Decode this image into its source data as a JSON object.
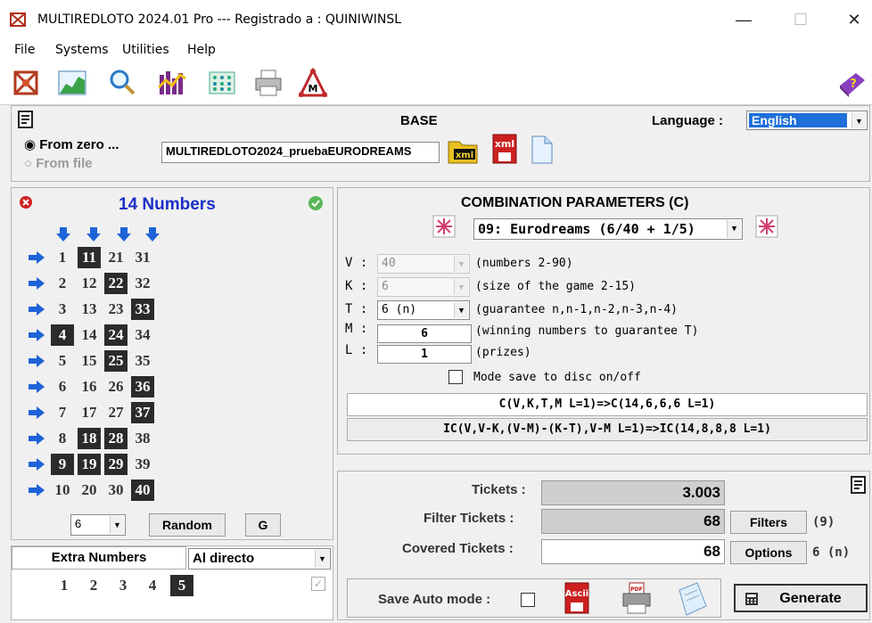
{
  "window": {
    "title": "MULTIREDLOTO 2024.01 Pro --- Registrado a : QUINIWINSL",
    "minimize": "—",
    "maximize": "☐",
    "close": "✕"
  },
  "menu": [
    "File",
    "Systems",
    "Utilities",
    "Help"
  ],
  "base": {
    "title": "BASE",
    "language_label": "Language :",
    "language_value": "English",
    "from_zero": "From zero ...",
    "from_file": "From file",
    "filename": "MULTIREDLOTO2024_pruebaEURODREAMS",
    "xml_label": "xml",
    "xml_label2": "xml"
  },
  "numbers_panel": {
    "title": "14 Numbers",
    "rows": [
      [
        {
          "n": "1",
          "s": false
        },
        {
          "n": "11",
          "s": true
        },
        {
          "n": "21",
          "s": false
        },
        {
          "n": "31",
          "s": false
        }
      ],
      [
        {
          "n": "2",
          "s": false
        },
        {
          "n": "12",
          "s": false
        },
        {
          "n": "22",
          "s": true
        },
        {
          "n": "32",
          "s": false
        }
      ],
      [
        {
          "n": "3",
          "s": false
        },
        {
          "n": "13",
          "s": false
        },
        {
          "n": "23",
          "s": false
        },
        {
          "n": "33",
          "s": true
        }
      ],
      [
        {
          "n": "4",
          "s": true
        },
        {
          "n": "14",
          "s": false
        },
        {
          "n": "24",
          "s": true
        },
        {
          "n": "34",
          "s": false
        }
      ],
      [
        {
          "n": "5",
          "s": false
        },
        {
          "n": "15",
          "s": false
        },
        {
          "n": "25",
          "s": true
        },
        {
          "n": "35",
          "s": false
        }
      ],
      [
        {
          "n": "6",
          "s": false
        },
        {
          "n": "16",
          "s": false
        },
        {
          "n": "26",
          "s": false
        },
        {
          "n": "36",
          "s": true
        }
      ],
      [
        {
          "n": "7",
          "s": false
        },
        {
          "n": "17",
          "s": false
        },
        {
          "n": "27",
          "s": false
        },
        {
          "n": "37",
          "s": true
        }
      ],
      [
        {
          "n": "8",
          "s": false
        },
        {
          "n": "18",
          "s": true
        },
        {
          "n": "28",
          "s": true
        },
        {
          "n": "38",
          "s": false
        }
      ],
      [
        {
          "n": "9",
          "s": true
        },
        {
          "n": "19",
          "s": true
        },
        {
          "n": "29",
          "s": true
        },
        {
          "n": "39",
          "s": false
        }
      ],
      [
        {
          "n": "10",
          "s": false
        },
        {
          "n": "20",
          "s": false
        },
        {
          "n": "30",
          "s": false
        },
        {
          "n": "40",
          "s": true
        }
      ]
    ],
    "random_count": "6",
    "random_button": "Random",
    "g_button": "G"
  },
  "extra": {
    "title": "Extra Numbers",
    "mode": "Al directo",
    "numbers": [
      {
        "n": "1",
        "s": false
      },
      {
        "n": "2",
        "s": false
      },
      {
        "n": "3",
        "s": false
      },
      {
        "n": "4",
        "s": false
      },
      {
        "n": "5",
        "s": true
      }
    ]
  },
  "combination": {
    "title": "COMBINATION PARAMETERS (C)",
    "game": "09: Eurodreams (6/40 + 1/5)",
    "params": [
      {
        "label": "V :",
        "value": "40",
        "desc": "(numbers 2-90)",
        "disabled": true
      },
      {
        "label": "K :",
        "value": "6",
        "desc": "(size of the game 2-15)",
        "disabled": true
      },
      {
        "label": "T :",
        "value": "6 (n)",
        "desc": "(guarantee n,n-1,n-2,n-3,n-4)",
        "disabled": false
      }
    ],
    "m_label": "M :",
    "m_value": "6",
    "m_desc": "(winning numbers to guarantee T)",
    "l_label": "L :",
    "l_value": "1",
    "l_desc": "(prizes)",
    "mode_save": "Mode save to disc on/off",
    "formula1": "C(V,K,T,M L=1)=>C(14,6,6,6 L=1)",
    "formula2": "IC(V,V-K,(V-M)-(K-T),V-M L=1)=>IC(14,8,8,8 L=1)"
  },
  "results": {
    "tickets_label": "Tickets :",
    "tickets_value": "3.003",
    "filter_label": "Filter Tickets :",
    "filter_value": "68",
    "filters_button": "Filters",
    "filters_count": "(9)",
    "covered_label": "Covered Tickets :",
    "covered_value": "68",
    "options_button": "Options",
    "options_value": "6 (n)",
    "save_auto": "Save Auto mode :",
    "ascii_label": "Ascii",
    "pdf_label": "PDF",
    "generate_button": "Generate"
  }
}
